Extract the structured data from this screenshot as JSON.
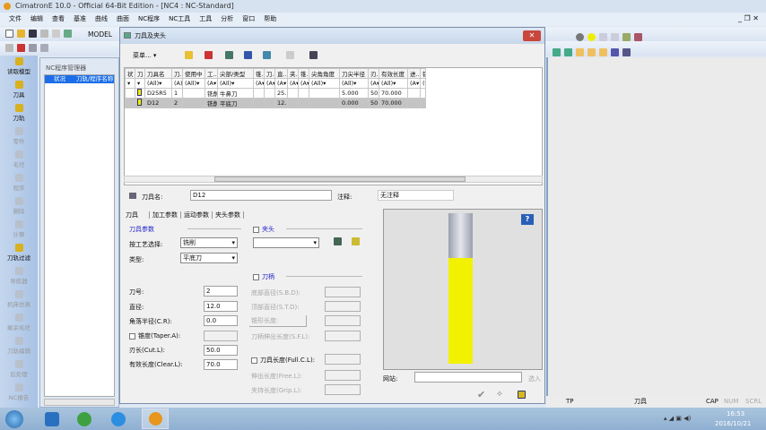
{
  "window": {
    "title": "CimatronE 10.0 - Official 64-Bit Edition - [NC4 : NC-Standard]"
  },
  "menu": [
    "文件",
    "编辑",
    "查看",
    "基准",
    "曲线",
    "曲面",
    "NC程序",
    "NC工具",
    "工具",
    "分析",
    "窗口",
    "帮助"
  ],
  "toolbar": {
    "model_label": "MODEL"
  },
  "leftbar": [
    {
      "label": "读取模型",
      "on": true
    },
    {
      "label": "刀具",
      "on": true
    },
    {
      "label": "刀轨",
      "on": true
    },
    {
      "label": "零件",
      "on": false
    },
    {
      "label": "毛坯",
      "on": false
    },
    {
      "label": "程序",
      "on": false
    },
    {
      "label": "删除",
      "on": false
    },
    {
      "label": "计算",
      "on": false
    },
    {
      "label": "刀轨过滤",
      "on": true
    },
    {
      "label": "导航器",
      "on": false
    },
    {
      "label": "机床仿真",
      "on": false
    },
    {
      "label": "剩余毛坯",
      "on": false
    },
    {
      "label": "刀轨编辑",
      "on": false
    },
    {
      "label": "后处理",
      "on": false
    },
    {
      "label": "NC报告",
      "on": false
    }
  ],
  "nc_manager": {
    "title": "NC程序管理器",
    "columns": [
      "状况",
      "刀轨/程序名称"
    ]
  },
  "dialog": {
    "title": "刀具及夹头",
    "menu_label": "菜单...",
    "close": "✕",
    "table": {
      "headers": [
        "状",
        "刀",
        "刀具名",
        "刀...",
        "使用中",
        "工...",
        "尖部/类型",
        "锥...",
        "刀...",
        "直...",
        "夹...",
        "锥...",
        "尖角角度",
        "刀尖半径",
        "刃...",
        "有效长度",
        "进...",
        "钐"
      ],
      "filters": [
        "",
        "",
        "(All)",
        "(A)",
        "(All)",
        "(A",
        "(All)",
        "(A",
        "(A",
        "(A",
        "(A",
        "(A",
        "(All)",
        "(All)",
        "(A",
        "(All)",
        "(A",
        "("
      ],
      "rows": [
        [
          "",
          "",
          "D25R5",
          "1",
          "",
          "铣削",
          "牛鼻刀",
          "",
          "",
          "25....",
          "",
          "",
          "",
          "5.000",
          "50....",
          "70.000",
          "",
          ""
        ],
        [
          "",
          "",
          "D12",
          "2",
          "",
          "铣削",
          "平底刀",
          "",
          "",
          "12....",
          "",
          "",
          "",
          "0.000",
          "50....",
          "70.000",
          "",
          ""
        ]
      ],
      "selected_row": 1
    },
    "form": {
      "tool_name_label": "刀具名:",
      "tool_name": "D12",
      "comment_label": "注释:",
      "comment": "无注释",
      "tabs": [
        "刀具",
        "加工参数",
        "运动参数",
        "夹头参数"
      ],
      "active_tab": 0,
      "tool_params_label": "刀具参数",
      "process_label": "按工艺选择:",
      "process": "铣削",
      "type_label": "类型:",
      "type": "平底刀",
      "number_label": "刀号:",
      "number": "2",
      "diameter_label": "直径:",
      "diameter": "12.0",
      "corner_label": "角落半径(C.R):",
      "corner": "0.0",
      "taper_label": "锥度(Taper.A):",
      "taper": "",
      "cut_label": "刃长(Cut.L):",
      "cut": "50.0",
      "clear_label": "有效长度(Clear.L):",
      "clear": "70.0",
      "holder_label": "夹头",
      "shank_label": "刀柄",
      "sbd_label": "底部直径(S.B.D):",
      "std_label": "顶部直径(S.T.D):",
      "cone_label": "锥形长度:",
      "sfl_label": "刀柄伸出长度(S.F.L):",
      "full_label": "刀具长度(Full.C.L):",
      "free_label": "伸出长度(Free.L):",
      "grip_label": "夹持长度(Grip.L):",
      "site_label": "网站:",
      "site": "",
      "select_in": "选入"
    }
  },
  "status": {
    "tp": "TP",
    "tool": "刀具",
    "cap": "CAP",
    "num": "NUM",
    "scrl": "SCRL"
  },
  "taskbar": {
    "time": "16:53",
    "date": "2016/10/21"
  }
}
